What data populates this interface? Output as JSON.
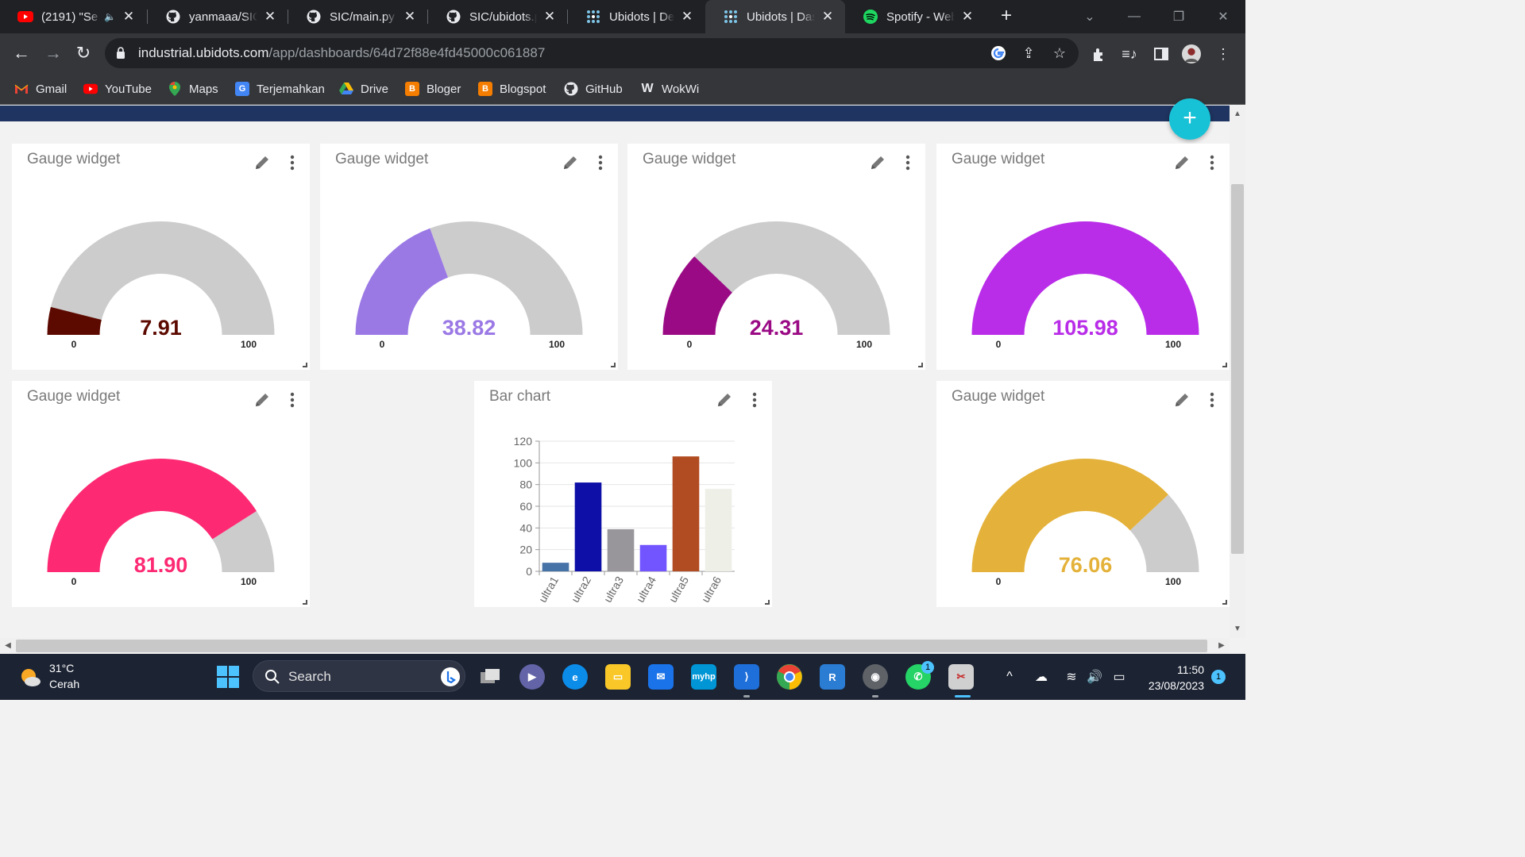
{
  "browser": {
    "tabs": [
      {
        "title": "(2191) \"Se",
        "icon": "youtube-icon",
        "muted": true
      },
      {
        "title": "yanmaaa/SIC",
        "icon": "github-icon"
      },
      {
        "title": "SIC/main.py at",
        "icon": "github-icon"
      },
      {
        "title": "SIC/ubidots.py",
        "icon": "github-icon"
      },
      {
        "title": "Ubidots | Devic",
        "icon": "ubidots-icon"
      },
      {
        "title": "Ubidots | Dashb",
        "icon": "ubidots-icon",
        "active": true
      },
      {
        "title": "Spotify - Web P",
        "icon": "spotify-icon"
      }
    ],
    "url_host": "industrial.ubidots.com",
    "url_path": "/app/dashboards/64d72f88e4fd45000c061887",
    "bookmarks": [
      {
        "label": "Gmail",
        "icon": "gmail-icon"
      },
      {
        "label": "YouTube",
        "icon": "youtube-icon"
      },
      {
        "label": "Maps",
        "icon": "maps-icon"
      },
      {
        "label": "Terjemahkan",
        "icon": "translate-icon"
      },
      {
        "label": "Drive",
        "icon": "drive-icon"
      },
      {
        "label": "Bloger",
        "icon": "blogger-icon"
      },
      {
        "label": "Blogspot",
        "icon": "blogger-icon"
      },
      {
        "label": "GitHub",
        "icon": "github-icon"
      },
      {
        "label": "WokWi",
        "icon": "wokwi-icon"
      }
    ]
  },
  "dashboard": {
    "gauges": [
      {
        "title": "Gauge widget",
        "value": 7.91,
        "display": "7.91",
        "min_label": "0",
        "max_label": "100",
        "min": 0,
        "max": 100,
        "color": "#5c0a00"
      },
      {
        "title": "Gauge widget",
        "value": 38.82,
        "display": "38.82",
        "min_label": "0",
        "max_label": "100",
        "min": 0,
        "max": 100,
        "color": "#9b79e5"
      },
      {
        "title": "Gauge widget",
        "value": 24.31,
        "display": "24.31",
        "min_label": "0",
        "max_label": "100",
        "min": 0,
        "max": 100,
        "color": "#9a0a85"
      },
      {
        "title": "Gauge widget",
        "value": 105.98,
        "display": "105.98",
        "min_label": "0",
        "max_label": "100",
        "min": 0,
        "max": 100,
        "color": "#b92de8"
      },
      {
        "title": "Gauge widget",
        "value": 81.9,
        "display": "81.90",
        "min_label": "0",
        "max_label": "100",
        "min": 0,
        "max": 100,
        "color": "#fd2a73"
      },
      {
        "title": "Gauge widget",
        "value": 76.06,
        "display": "76.06",
        "min_label": "0",
        "max_label": "100",
        "min": 0,
        "max": 100,
        "color": "#e4b23a"
      }
    ],
    "bar_widget_title": "Bar chart",
    "track_color": "#cccccc"
  },
  "chart_data": {
    "type": "bar",
    "title": "Bar chart",
    "categories": [
      "ultra1",
      "ultra2",
      "ultra3",
      "ultra4",
      "ultra5",
      "ultra6"
    ],
    "values": [
      7.91,
      81.9,
      38.82,
      24.31,
      105.98,
      76.06
    ],
    "colors": [
      "#4572a7",
      "#0d0fa6",
      "#98969b",
      "#7355ff",
      "#b14b21",
      "#eef0e8"
    ],
    "ylim": [
      0,
      120
    ],
    "yticks": [
      "0",
      "20",
      "40",
      "60",
      "80",
      "100",
      "120"
    ],
    "grid": true,
    "xlabel": "",
    "ylabel": ""
  },
  "taskbar": {
    "weather_temp": "31°C",
    "weather_cond": "Cerah",
    "search_label": "Search",
    "time": "11:50",
    "date": "23/08/2023",
    "notification_count": "1",
    "whatsapp_badge": "1"
  }
}
